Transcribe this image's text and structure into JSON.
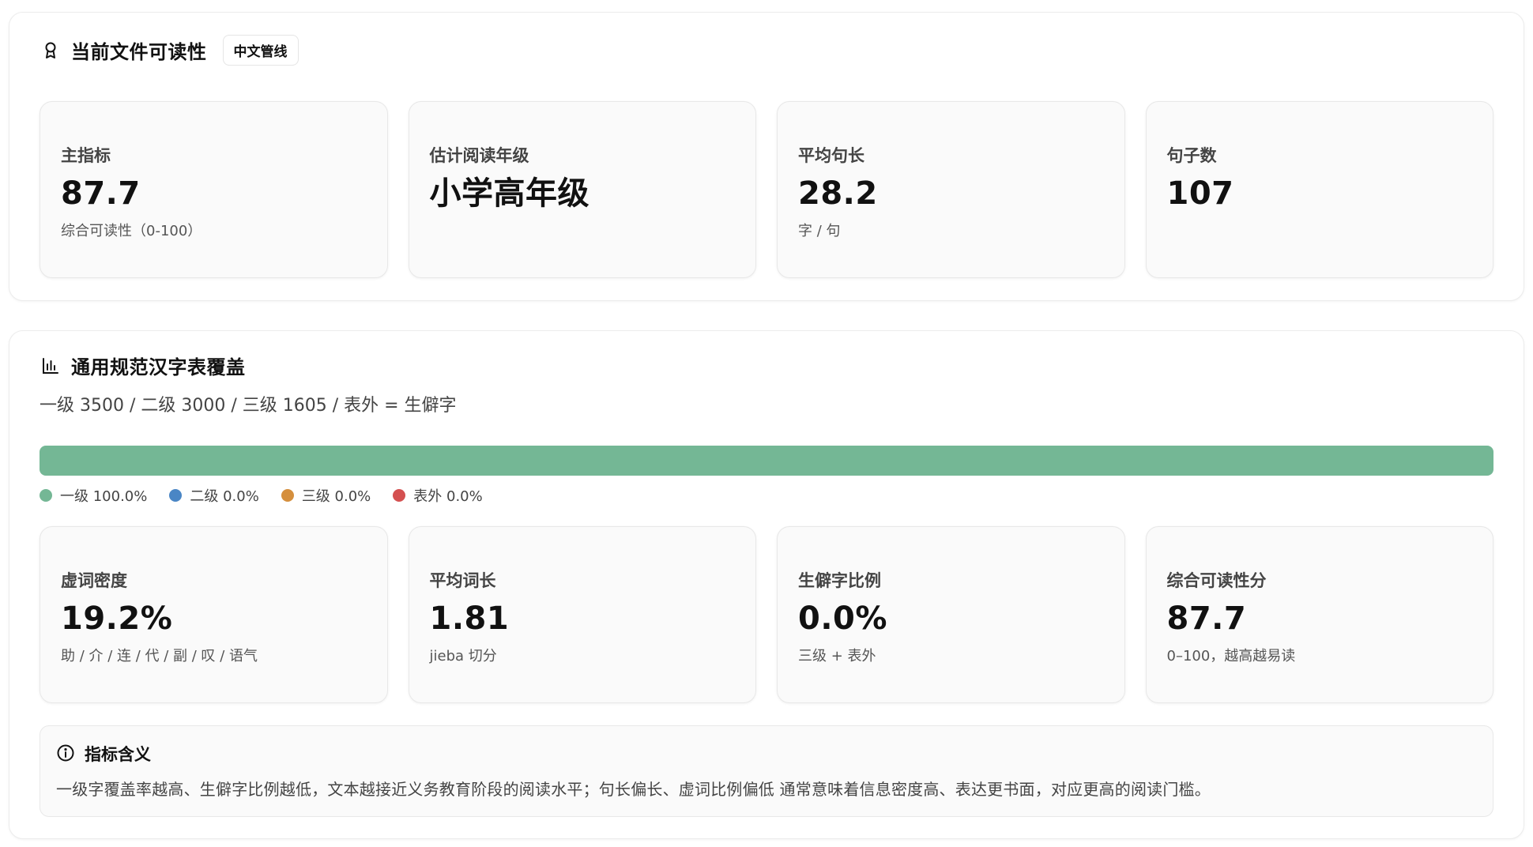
{
  "readability": {
    "title": "当前文件可读性",
    "tag": "中文管线",
    "icon": "award-ribbon-icon",
    "cards": [
      {
        "label": "主指标",
        "value": "87.7",
        "sub": "综合可读性（0-100）"
      },
      {
        "label": "估计阅读年级",
        "value": "小学高年级",
        "sub": ""
      },
      {
        "label": "平均句长",
        "value": "28.2",
        "sub": "字 / 句"
      },
      {
        "label": "句子数",
        "value": "107",
        "sub": ""
      }
    ]
  },
  "coverage": {
    "title": "通用规范汉字表覆盖",
    "icon": "bar-chart-icon",
    "description": "一级 3500 / 二级 3000 / 三级 1605 / 表外 = 生僻字",
    "segments": [
      {
        "label": "一级 100.0%",
        "fraction": 1.0,
        "color": "#74b795"
      },
      {
        "label": "二级 0.0%",
        "fraction": 0.0,
        "color": "#4a86c5"
      },
      {
        "label": "三级 0.0%",
        "fraction": 0.0,
        "color": "#d58f3d"
      },
      {
        "label": "表外 0.0%",
        "fraction": 0.0,
        "color": "#d45050"
      }
    ],
    "cards": [
      {
        "label": "虚词密度",
        "value": "19.2%",
        "sub": "助 / 介 / 连 / 代 / 副 / 叹 / 语气"
      },
      {
        "label": "平均词长",
        "value": "1.81",
        "sub": "jieba 切分"
      },
      {
        "label": "生僻字比例",
        "value": "0.0%",
        "sub": "三级 + 表外"
      },
      {
        "label": "综合可读性分",
        "value": "87.7",
        "sub": "0–100，越高越易读"
      }
    ],
    "note": {
      "icon": "info-circle-icon",
      "title": "指标含义",
      "text": "一级字覆盖率越高、生僻字比例越低，文本越接近义务教育阶段的阅读水平；句长偏长、虚词比例偏低 通常意味着信息密度高、表达更书面，对应更高的阅读门槛。"
    }
  }
}
